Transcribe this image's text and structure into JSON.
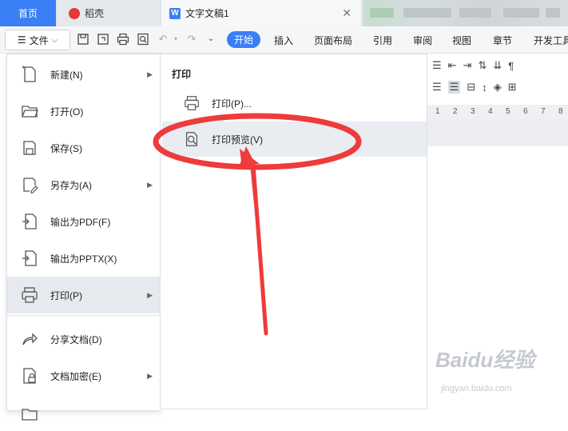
{
  "tabs": {
    "home": "首页",
    "daoke": "稻壳",
    "doc": "文字文稿1",
    "doc_icon": "W"
  },
  "toolbar": {
    "file_label": "文件",
    "ribbon": [
      "开始",
      "插入",
      "页面布局",
      "引用",
      "审阅",
      "视图",
      "章节",
      "开发工具"
    ]
  },
  "menu": {
    "items": [
      {
        "label": "新建(N)",
        "icon": "new-document-icon",
        "submenu": true
      },
      {
        "label": "打开(O)",
        "icon": "folder-open-icon",
        "submenu": false
      },
      {
        "label": "保存(S)",
        "icon": "save-icon",
        "submenu": false
      },
      {
        "label": "另存为(A)",
        "icon": "save-as-icon",
        "submenu": true
      },
      {
        "label": "输出为PDF(F)",
        "icon": "export-pdf-icon",
        "submenu": false
      },
      {
        "label": "输出为PPTX(X)",
        "icon": "export-pptx-icon",
        "submenu": false
      },
      {
        "label": "打印(P)",
        "icon": "printer-icon",
        "submenu": true
      },
      {
        "label": "分享文档(D)",
        "icon": "share-icon",
        "submenu": false
      },
      {
        "label": "文档加密(E)",
        "icon": "encrypt-icon",
        "submenu": true
      }
    ]
  },
  "submenu": {
    "title": "打印",
    "items": [
      {
        "label": "打印(P)...",
        "icon": "printer-icon"
      },
      {
        "label": "打印预览(V)",
        "icon": "print-preview-icon"
      }
    ]
  },
  "ruler_numbers": [
    "1",
    "2",
    "3",
    "4",
    "5",
    "6",
    "7",
    "8"
  ],
  "watermark": {
    "brand": "Baidu经验",
    "url": "jingyan.baidu.com"
  },
  "colors": {
    "accent": "#3a7ff6",
    "annotation": "#ee3b3b",
    "active_bg": "#e6e9ee"
  }
}
